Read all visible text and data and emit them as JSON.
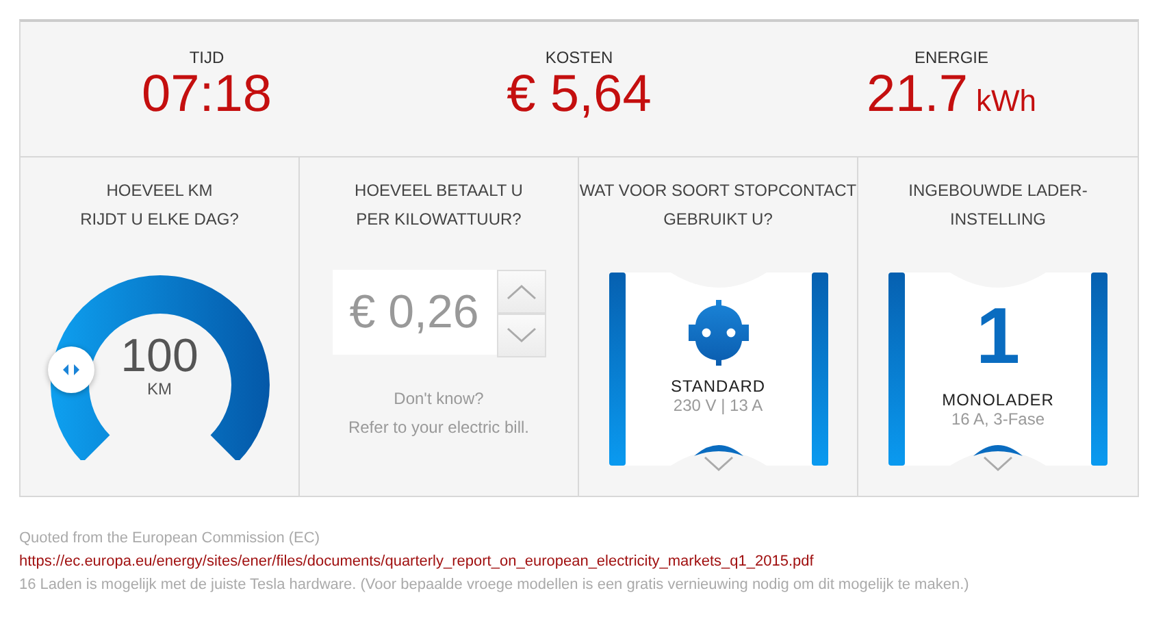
{
  "stats": [
    {
      "label": "TIJD",
      "value": "07:18"
    },
    {
      "label": "KOSTEN",
      "value": "€ 5,64"
    },
    {
      "label": "ENERGIE",
      "value": "21.7",
      "unit": "kWh"
    }
  ],
  "panels": [
    {
      "kind": "gauge",
      "question": "HOEVEEL KM\nRIJDT U ELKE DAG?",
      "value": "100",
      "unit": "KM"
    },
    {
      "kind": "stepper",
      "question": "HOEVEEL BETAALT U\nPER KILOWATTUUR?",
      "value": "€ 0,26",
      "hint": "Don't know?\nRefer to your electric bill."
    },
    {
      "kind": "socket-card",
      "question": "WAT VOOR SOORT STOPCONTACT\nGEBRUIKT U?",
      "title": "STANDARD",
      "subtitle": "230 V | 13 A"
    },
    {
      "kind": "number-card",
      "question": "INGEBOUWDE LADER-\nINSTELLING",
      "big": "1",
      "title": "MONOLADER",
      "subtitle": "16 A, 3-Fase"
    }
  ],
  "footer": {
    "source": "Quoted from the European Commission (EC)",
    "link": "https://ec.europa.eu/energy/sites/ener/files/documents/quarterly_report_on_european_electricity_markets_q1_2015.pdf",
    "note": "16 Laden is mogelijk met de juiste Tesla hardware. (Voor bepaalde vroege modellen is een gratis vernieuwing nodig om dit mogelijk te maken.)"
  }
}
